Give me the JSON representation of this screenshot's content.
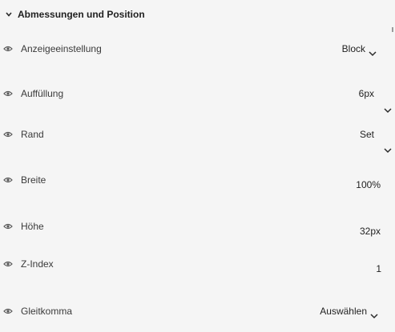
{
  "section": {
    "title": "Abmessungen und Position"
  },
  "icons": {
    "visibility": "eye-icon",
    "collapse": "chevron-down-icon",
    "dropdown": "chevron-down-icon"
  },
  "properties": [
    {
      "label": "Anzeigeeinstellung",
      "value": "Block"
    },
    {
      "label": "Auffüllung",
      "value": "6px"
    },
    {
      "label": "Rand",
      "value": "Set"
    },
    {
      "label": "Breite",
      "value": "100%"
    },
    {
      "label": "Höhe",
      "value": "32px"
    },
    {
      "label": "Z-Index",
      "value": "1"
    },
    {
      "label": "Gleitkomma",
      "value": "Auswählen"
    }
  ],
  "colors": {
    "background": "#f5f5f5",
    "text": "#2c2c2c",
    "icon": "#5a5a5a"
  }
}
